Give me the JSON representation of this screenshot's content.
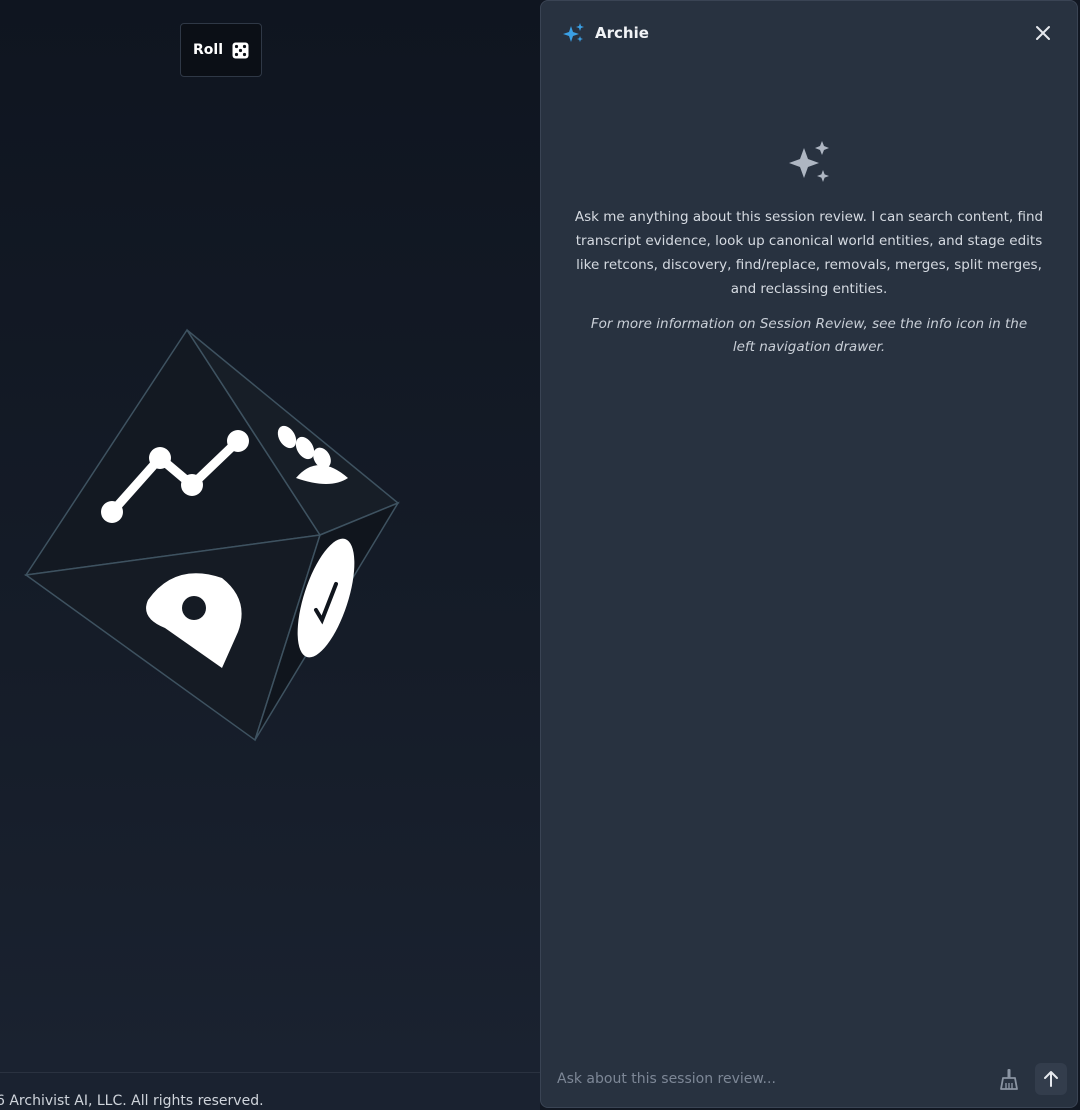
{
  "stage": {
    "roll_label": "Roll",
    "roll_icon": "dice-icon"
  },
  "footer": {
    "copyright": "6 Archivist AI, LLC. All rights reserved."
  },
  "assistant": {
    "title": "Archie",
    "title_icon": "sparkles-icon",
    "close_icon": "close-icon",
    "welcome_icon": "sparkles-icon",
    "welcome_text": "Ask me anything about this session review. I can search content, find transcript evidence, look up canonical world entities, and stage edits like retcons, discovery, find/replace, removals, merges, split merges, and reclassing entities.",
    "welcome_note": "For more information on Session Review, see the info icon in the left navigation drawer.",
    "input_placeholder": "Ask about this session review...",
    "clear_icon": "broom-icon",
    "send_icon": "arrow-up-icon"
  },
  "colors": {
    "accent": "#3aa0e6",
    "panel_bg": "#283240",
    "stage_bg": "#111722"
  }
}
